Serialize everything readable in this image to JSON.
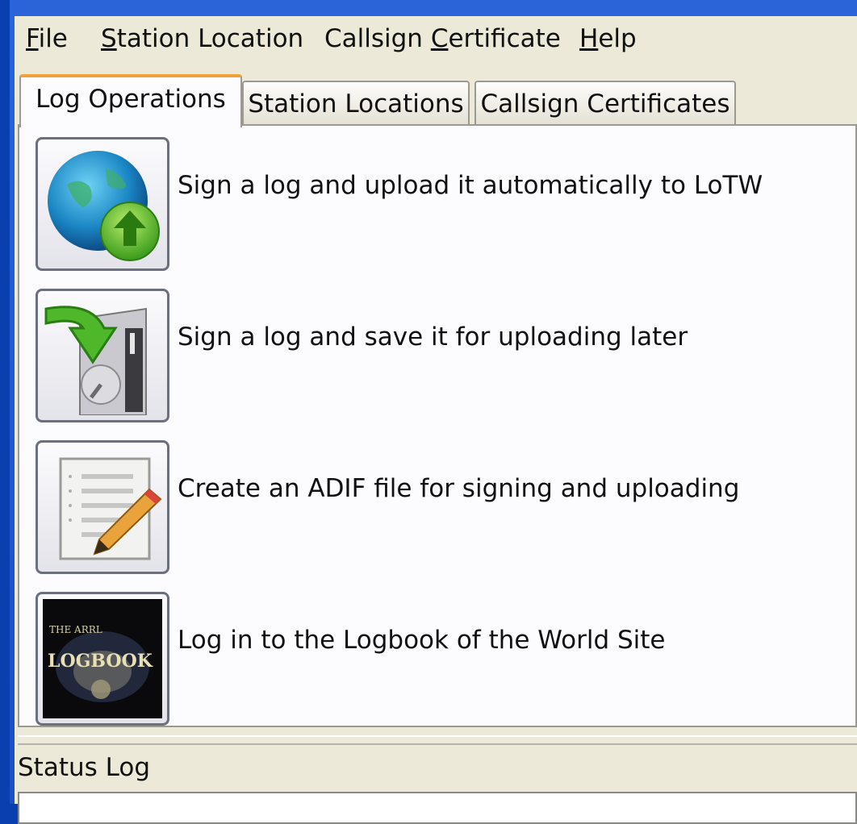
{
  "menu": {
    "items": [
      {
        "pre": "",
        "u": "F",
        "post": "ile"
      },
      {
        "pre": "",
        "u": "S",
        "post": "tation Location"
      },
      {
        "pre": "Callsign ",
        "u": "C",
        "post": "ertificate"
      },
      {
        "pre": "",
        "u": "H",
        "post": "elp"
      }
    ]
  },
  "tabs": [
    "Log Operations",
    "Station Locations",
    "Callsign Certificates"
  ],
  "operations": [
    {
      "label": "Sign a log and upload it automatically to LoTW",
      "icon": "globe-upload-icon"
    },
    {
      "label": "Sign a log and save it for uploading later",
      "icon": "save-to-disk-icon"
    },
    {
      "label": "Create an ADIF file for signing and uploading",
      "icon": "edit-document-icon"
    },
    {
      "label": "Log in to the Logbook of the World Site",
      "icon": "logbook-logo-icon"
    }
  ],
  "logo": {
    "line1": "THE ARRL",
    "line2": "LOGBOOK"
  },
  "status": {
    "title": "Status Log"
  },
  "colors": {
    "window_blue": "#1b4fc4",
    "face": "#ece9d8",
    "tab_accent": "#f0a238"
  }
}
